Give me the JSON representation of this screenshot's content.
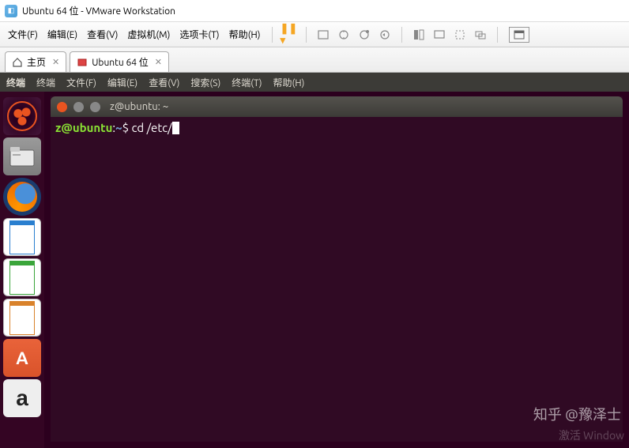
{
  "window": {
    "title": "Ubuntu 64 位 - VMware Workstation"
  },
  "menubar": {
    "file": "文件(F)",
    "edit": "编辑(E)",
    "view": "查看(V)",
    "vm": "虚拟机(M)",
    "tabs": "选项卡(T)",
    "help": "帮助(H)"
  },
  "tabs": {
    "home": "主页",
    "guest": "Ubuntu 64 位"
  },
  "ubuntu_menu": {
    "app": "终端",
    "terminal": "终端",
    "file": "文件(F)",
    "edit": "编辑(E)",
    "view": "查看(V)",
    "search": "搜索(S)",
    "terminal2": "终端(T)",
    "help": "帮助(H)"
  },
  "terminal": {
    "title": "z@ubuntu: ~",
    "prompt_user": "z@ubuntu",
    "prompt_sep": ":",
    "prompt_path": "~",
    "prompt_sym": "$ ",
    "command": "cd /etc/"
  },
  "watermark": {
    "main": "知乎 @豫泽士",
    "sub": "激活 Window"
  }
}
